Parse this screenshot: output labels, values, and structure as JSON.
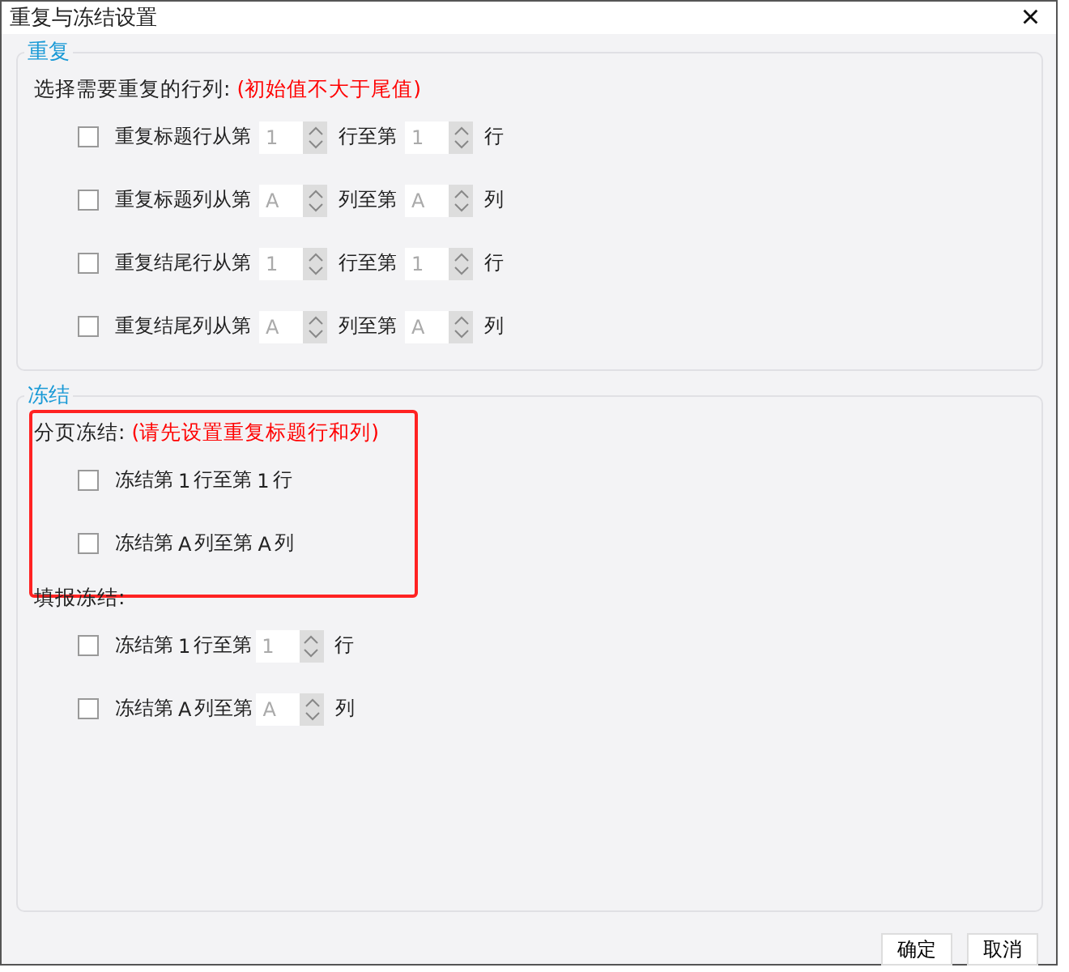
{
  "window": {
    "title": "重复与冻结设置",
    "close": "×"
  },
  "repeat": {
    "legend": "重复",
    "prompt": "选择需要重复的行列:",
    "note": "(初始值不大于尾值)",
    "rows": [
      {
        "checked": false,
        "parts": [
          {
            "kind": "text",
            "text": "重复标题行从第"
          },
          {
            "kind": "spinner",
            "value": "1",
            "disabled": true
          },
          {
            "kind": "text",
            "text": "行至第"
          },
          {
            "kind": "spinner",
            "value": "1",
            "disabled": true
          },
          {
            "kind": "text",
            "text": "行"
          }
        ]
      },
      {
        "checked": false,
        "parts": [
          {
            "kind": "text",
            "text": "重复标题列从第"
          },
          {
            "kind": "spinner",
            "value": "A",
            "disabled": true
          },
          {
            "kind": "text",
            "text": "列至第"
          },
          {
            "kind": "spinner",
            "value": "A",
            "disabled": true
          },
          {
            "kind": "text",
            "text": "列"
          }
        ]
      },
      {
        "checked": false,
        "parts": [
          {
            "kind": "text",
            "text": "重复结尾行从第"
          },
          {
            "kind": "spinner",
            "value": "1",
            "disabled": true
          },
          {
            "kind": "text",
            "text": "行至第"
          },
          {
            "kind": "spinner",
            "value": "1",
            "disabled": true
          },
          {
            "kind": "text",
            "text": "行"
          }
        ]
      },
      {
        "checked": false,
        "parts": [
          {
            "kind": "text",
            "text": "重复结尾列从第"
          },
          {
            "kind": "spinner",
            "value": "A",
            "disabled": true
          },
          {
            "kind": "text",
            "text": "列至第"
          },
          {
            "kind": "spinner",
            "value": "A",
            "disabled": true
          },
          {
            "kind": "text",
            "text": "列"
          }
        ]
      }
    ]
  },
  "freeze": {
    "legend": "冻结",
    "groups": [
      {
        "label": "分页冻结:",
        "note": "(请先设置重复标题行和列)",
        "highlighted": true,
        "rows": [
          {
            "checked": false,
            "parts": [
              {
                "kind": "text",
                "text": "冻结第"
              },
              {
                "kind": "value",
                "text": "1"
              },
              {
                "kind": "text",
                "text": "行至第"
              },
              {
                "kind": "value",
                "text": "1"
              },
              {
                "kind": "text",
                "text": "行"
              }
            ]
          },
          {
            "checked": false,
            "parts": [
              {
                "kind": "text",
                "text": "冻结第"
              },
              {
                "kind": "value",
                "text": "A"
              },
              {
                "kind": "text",
                "text": "列至第"
              },
              {
                "kind": "value",
                "text": "A"
              },
              {
                "kind": "text",
                "text": "列"
              }
            ]
          }
        ]
      },
      {
        "label": "填报冻结:",
        "highlighted": false,
        "rows": [
          {
            "checked": false,
            "parts": [
              {
                "kind": "text",
                "text": "冻结第"
              },
              {
                "kind": "value",
                "text": "1"
              },
              {
                "kind": "text",
                "text": "行至第"
              },
              {
                "kind": "spinner",
                "value": "1",
                "disabled": true
              },
              {
                "kind": "text",
                "text": "行"
              }
            ]
          },
          {
            "checked": false,
            "parts": [
              {
                "kind": "text",
                "text": "冻结第"
              },
              {
                "kind": "value",
                "text": "A"
              },
              {
                "kind": "text",
                "text": "列至第"
              },
              {
                "kind": "spinner",
                "value": "A",
                "disabled": true
              },
              {
                "kind": "text",
                "text": "列"
              }
            ]
          }
        ]
      }
    ]
  },
  "buttons": [
    "确定",
    "取消"
  ]
}
